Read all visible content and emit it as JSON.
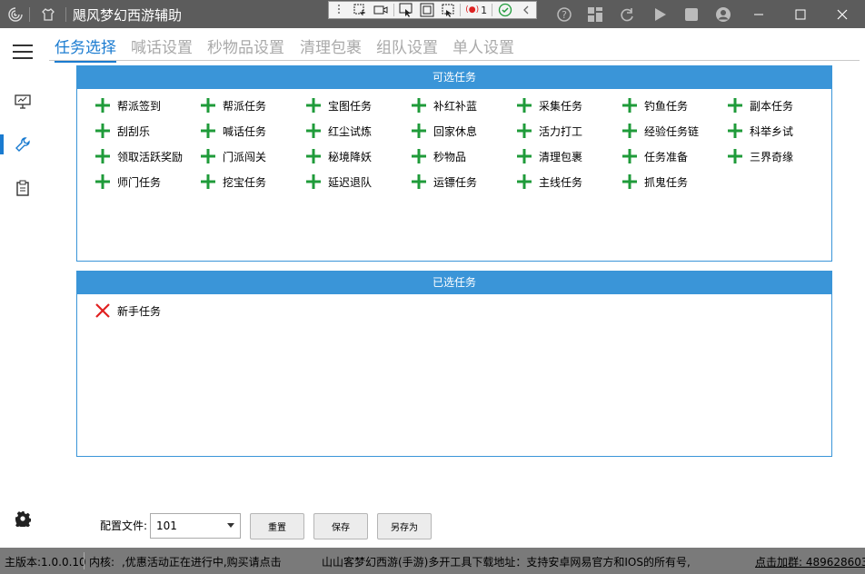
{
  "window": {
    "title": "飓风梦幻西游辅助",
    "app_icon": "swirl-icon",
    "shirt_icon": "shirt-icon"
  },
  "floating_toolbar": {
    "record_count": "1"
  },
  "sidebar": {
    "items": [
      {
        "name": "monitor-icon"
      },
      {
        "name": "wrench-icon",
        "active": true
      },
      {
        "name": "clipboard-icon"
      }
    ],
    "settings_icon": "gear-icon"
  },
  "tabs": [
    {
      "label": "任务选择",
      "active": true
    },
    {
      "label": "喊话设置"
    },
    {
      "label": "秒物品设置"
    },
    {
      "label": "清理包裹"
    },
    {
      "label": "组队设置"
    },
    {
      "label": "单人设置"
    }
  ],
  "available_panel": {
    "header": "可选任务",
    "rows": [
      [
        "帮派签到",
        "帮派任务",
        "宝图任务",
        "补红补蓝",
        "采集任务",
        "钓鱼任务",
        "副本任务"
      ],
      [
        "刮刮乐",
        "喊话任务",
        "红尘试炼",
        "回家休息",
        "活力打工",
        "经验任务链",
        "科举乡试"
      ],
      [
        "领取活跃奖励",
        "门派闯关",
        "秘境降妖",
        "秒物品",
        "清理包裹",
        "任务准备",
        "三界奇缘"
      ],
      [
        "师门任务",
        "挖宝任务",
        "延迟退队",
        "运镖任务",
        "主线任务",
        "抓鬼任务"
      ]
    ]
  },
  "selected_panel": {
    "header": "已选任务",
    "items": [
      "新手任务"
    ]
  },
  "config": {
    "label": "配置文件:",
    "value": "101",
    "reset_label": "重置",
    "save_label": "保存",
    "save_as_label": "另存为"
  },
  "status": {
    "version": "主版本:1.0.0.10",
    "kernel_label": "内核:",
    "promo": ",优惠活动正在进行中,购买请点击",
    "download": "山山客梦幻西游(手游)多开工具下载地址：支持安卓网易官方和IOS的所有号,",
    "group": "点击加群: 489628603"
  },
  "colors": {
    "accent": "#1a7bd0",
    "panel_header": "#3a95d8",
    "add_icon": "#1f9b3a",
    "remove_icon": "#e02020",
    "titlebar": "#5c5c5c",
    "statusbar": "#7a7a7a"
  }
}
